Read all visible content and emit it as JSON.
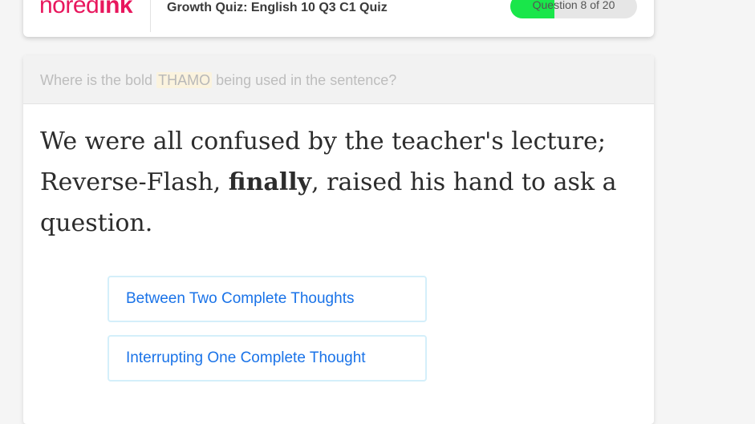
{
  "header": {
    "logo_light": "no",
    "logo_mid": "red",
    "logo_bold": "ink",
    "quiz_title": "Growth Quiz: English 10 Q3 C1 Quiz",
    "progress": {
      "label": "Question 8 of 20",
      "fraction": 0.35,
      "fill_color": "#19e64a"
    }
  },
  "question": {
    "prompt_before": "Where is the bold ",
    "prompt_highlight": "THAMO",
    "prompt_after": " being used in the sentence?",
    "sentence_part1": "We were all confused by the teacher's lecture; Reverse-Flash, ",
    "sentence_bold": "finally",
    "sentence_part2": ", raised his hand to ask a question."
  },
  "answers": [
    {
      "label": "Between Two Complete Thoughts"
    },
    {
      "label": "Interrupting One Complete Thought"
    }
  ],
  "colors": {
    "brand": "#e8175d",
    "answer_text": "#1a73e8",
    "answer_border": "#d4effa"
  }
}
